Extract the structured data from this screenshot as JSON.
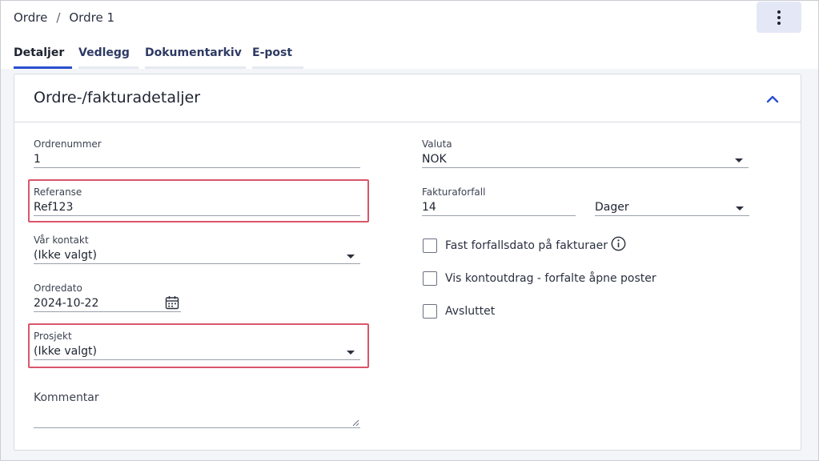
{
  "breadcrumb": {
    "parent": "Ordre",
    "separator": "/",
    "current": "Ordre 1"
  },
  "header": {
    "more_icon": "more-vertical-icon"
  },
  "tabs": [
    {
      "label": "Detaljer",
      "active": true
    },
    {
      "label": "Vedlegg",
      "active": false
    },
    {
      "label": "Dokumentarkiv",
      "active": false
    },
    {
      "label": "E-post",
      "active": false
    }
  ],
  "card": {
    "title": "Ordre-/fakturadetaljer",
    "collapse_icon": "chevron-up-icon"
  },
  "left_fields": {
    "ordrenummer": {
      "label": "Ordrenummer",
      "value": "1"
    },
    "referanse": {
      "label": "Referanse",
      "value": "Ref123"
    },
    "var_kontakt": {
      "label": "Vår kontakt",
      "value": "(Ikke valgt)"
    },
    "ordredato": {
      "label": "Ordredato",
      "value": "2024-10-22"
    },
    "prosjekt": {
      "label": "Prosjekt",
      "value": "(Ikke valgt)"
    },
    "kommentar": {
      "label": "Kommentar",
      "value": ""
    }
  },
  "right_fields": {
    "valuta": {
      "label": "Valuta",
      "value": "NOK"
    },
    "fakturaforfall": {
      "label": "Fakturaforfall",
      "value": "14"
    },
    "forfall_enhet": {
      "value": "Dager"
    }
  },
  "checkboxes": [
    {
      "label": "Fast forfallsdato på fakturaer",
      "checked": false,
      "has_info": true
    },
    {
      "label": "Vis kontoutdrag - forfalte åpne poster",
      "checked": false,
      "has_info": false
    },
    {
      "label": "Avsluttet",
      "checked": false,
      "has_info": false
    }
  ],
  "colors": {
    "accent": "#2a4fd0",
    "highlight": "#d9566a",
    "more_button_bg": "#e4e8f6"
  }
}
